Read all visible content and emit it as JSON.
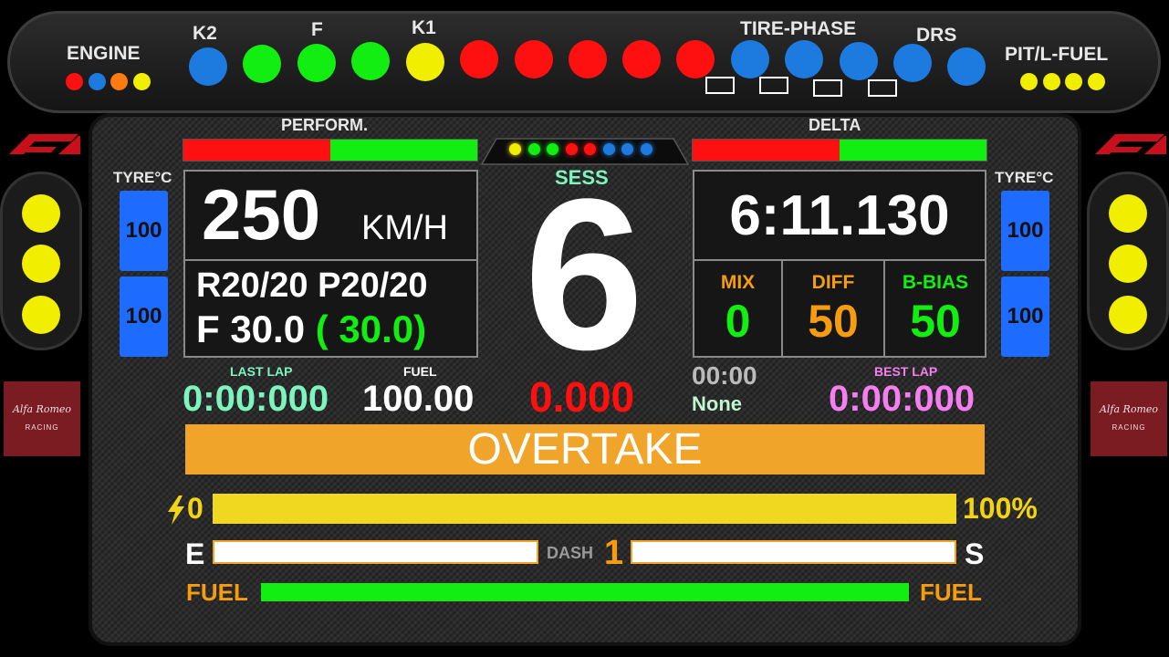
{
  "top": {
    "engine_label": "ENGINE",
    "k2_label": "K2",
    "f_label": "F",
    "k1_label": "K1",
    "tire_phase_label": "TIRE-PHASE",
    "drs_label": "DRS",
    "pitfuel_label": "PIT/L-FUEL",
    "engine_leds": [
      "#ff1010",
      "#1d7be0",
      "#ff7a10",
      "#f2ee00"
    ],
    "shift_leds": [
      "#1d7be0",
      "#12ee12",
      "#12ee12",
      "#12ee12",
      "#f2ee00",
      "#ff1010",
      "#ff1010",
      "#ff1010",
      "#ff1010",
      "#ff1010",
      "#1d7be0",
      "#1d7be0",
      "#1d7be0",
      "#1d7be0",
      "#1d7be0"
    ],
    "pit_leds": [
      "#f2ee00",
      "#f2ee00",
      "#f2ee00",
      "#f2ee00"
    ]
  },
  "perform": {
    "label": "PERFORM.",
    "value_pct": 50
  },
  "delta": {
    "label": "DELTA",
    "value_pct": 50
  },
  "center_leds": [
    "#f2ee00",
    "#12ee12",
    "#12ee12",
    "#ff1010",
    "#ff1010",
    "#1d7be0",
    "#1d7be0",
    "#1d7be0"
  ],
  "tyre": {
    "left_label": "TYRE°C",
    "right_label": "TYRE°C",
    "left": [
      "100",
      "100"
    ],
    "right": [
      "100",
      "100"
    ]
  },
  "speed": {
    "value": "250",
    "unit": "KM/H"
  },
  "setup": {
    "r": "R",
    "r_val": "20/20",
    "p": "P",
    "p_val": "20/20",
    "f": "F",
    "f_val": "30.0",
    "f_paren_open": "(",
    "f_target": "30.0)"
  },
  "session": {
    "label": "SESS",
    "gear": "6",
    "delta_value": "0.000"
  },
  "laptime": {
    "value": "6:11.130"
  },
  "mix": {
    "label": "MIX",
    "value": "0"
  },
  "diff": {
    "label": "DIFF",
    "value": "50"
  },
  "bbias": {
    "label": "B-BIAS",
    "value": "50"
  },
  "last_lap": {
    "label": "LAST LAP",
    "value": "0:00:000"
  },
  "fuel_info": {
    "label": "FUEL",
    "value": "100.00"
  },
  "timer": {
    "value": "00:00",
    "sub": "None"
  },
  "best_lap": {
    "label": "BEST LAP",
    "value": "0:00:000"
  },
  "overtake": {
    "label": "OVERTAKE"
  },
  "ers": {
    "min_label": "0",
    "max_label": "100%",
    "value_pct": 100
  },
  "dash": {
    "e": "E",
    "s": "S",
    "label": "DASH",
    "value": "1"
  },
  "fuel_bar": {
    "left": "FUEL",
    "right": "FUEL",
    "value_pct": 100
  },
  "logos": {
    "left_brand": "Alfa Romeo",
    "left_sub": "RACING",
    "right_brand": "Alfa Romeo",
    "right_sub": "RACING"
  },
  "colors": {
    "red": "#ff1010",
    "green": "#12ee12",
    "blue": "#1d6bff",
    "yellow": "#f2ee00",
    "orange": "#f59c10",
    "overtake": "#f0a52a"
  }
}
